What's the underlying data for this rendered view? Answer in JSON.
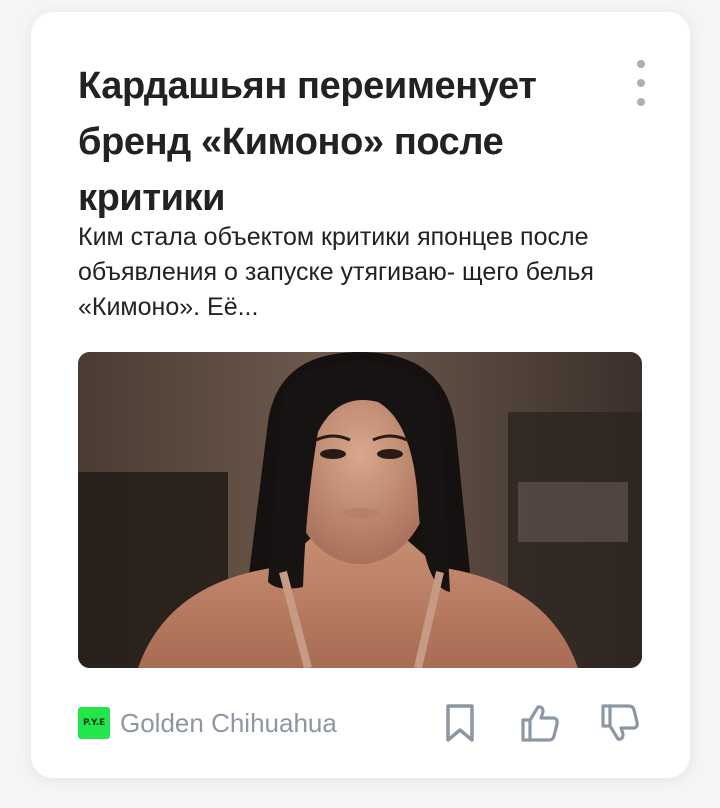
{
  "article": {
    "title": "Кардашьян переименует бренд «Кимоно» после критики",
    "snippet": "Ким стала объектом критики японцев после объявления о запуске утягиваю- щего белья «Кимоно». Её..."
  },
  "source": {
    "logo_text": "P.Y.E",
    "name": "Golden Chihuahua"
  },
  "icons": {
    "menu": "more-vertical-icon",
    "bookmark": "bookmark-icon",
    "like": "thumbs-up-icon",
    "dislike": "thumbs-down-icon"
  },
  "colors": {
    "source_logo_bg": "#22e64a",
    "icon_gray": "#8d96a3"
  }
}
